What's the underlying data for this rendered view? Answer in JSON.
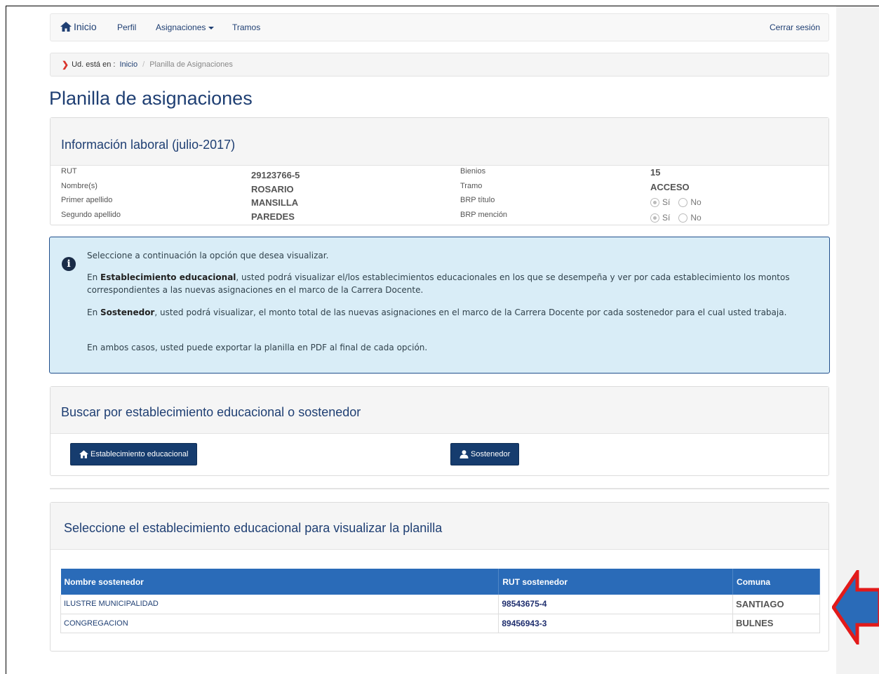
{
  "navbar": {
    "home": "Inicio",
    "perfil": "Perfil",
    "asignaciones": "Asignaciones",
    "tramos": "Tramos",
    "logout": "Cerrar sesión"
  },
  "breadcrumb": {
    "prefix": "Ud. está en :",
    "home": "Inicio",
    "separator": "/",
    "current": "Planilla de Asignaciones"
  },
  "page_title": "Planilla de asignaciones",
  "info": {
    "title": "Información laboral (julio-2017)",
    "rut_label": "RUT",
    "rut": "29123766-5",
    "nombre_label": "Nombre(s)",
    "nombre": "ROSARIO",
    "primer_label": "Primer apellido",
    "primer": "MANSILLA",
    "segundo_label": "Segundo apellido",
    "segundo": "PAREDES",
    "bienios_label": "Bienios",
    "bienios": "15",
    "tramo_label": "Tramo",
    "tramo": "ACCESO",
    "brp_titulo_label": "BRP título",
    "brp_mencion_label": "BRP mención",
    "si": "Sí",
    "no": "No"
  },
  "alert": {
    "p1": "Seleccione a continuación la opción que desea visualizar.",
    "p2_pre": "En ",
    "p2_bold": "Establecimiento educacional",
    "p2_post": ", usted podrá visualizar el/los establecimientos educacionales en los que se desempeña y ver por cada establecimiento los montos correspondientes a las nuevas asignaciones en el marco de la Carrera Docente.",
    "p3_pre": "En ",
    "p3_bold": "Sostenedor",
    "p3_post": ", usted podrá visualizar, el monto total de las nuevas asignaciones en el marco de la Carrera Docente por cada sostenedor para el cual usted trabaja.",
    "p4": "En ambos casos, usted puede exportar la planilla en PDF al final de cada opción."
  },
  "search": {
    "title": "Buscar por establecimiento educacional o sostenedor",
    "btn_establecimiento": "Establecimiento educacional",
    "btn_sostenedor": "Sostenedor"
  },
  "table": {
    "title": "Seleccione el establecimiento educacional para visualizar la planilla",
    "headers": [
      "Nombre sostenedor",
      "RUT sostenedor",
      "Comuna"
    ],
    "rows": [
      {
        "nombre": "ILUSTRE MUNICIPALIDAD",
        "rut": "98543675-4",
        "comuna": "SANTIAGO"
      },
      {
        "nombre": "CONGREGACION",
        "rut": "89456943-3",
        "comuna": "BULNES"
      }
    ]
  },
  "colors": {
    "brand": "#1f3f73",
    "button": "#163c6e",
    "table_header": "#2a6bb8",
    "alert_bg": "#d9edf7",
    "arrow_fill": "#2a6bb8",
    "arrow_outline": "#e21a1a"
  }
}
